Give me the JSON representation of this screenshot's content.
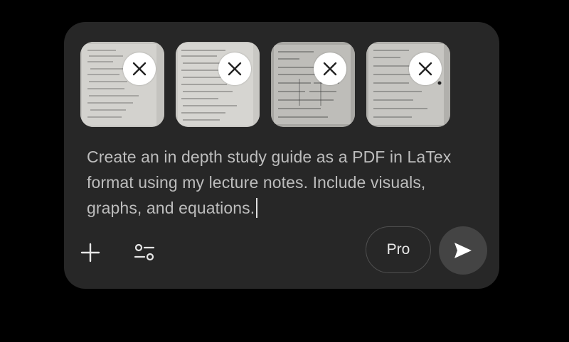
{
  "composer": {
    "attachments": [
      {
        "label": "lecture notes page 1",
        "remove_icon": "close-icon"
      },
      {
        "label": "lecture notes page 2",
        "remove_icon": "close-icon"
      },
      {
        "label": "lecture notes page 3",
        "remove_icon": "close-icon"
      },
      {
        "label": "lecture notes page 4",
        "remove_icon": "close-icon"
      }
    ],
    "prompt_text": "Create an in depth study guide as a PDF in LaTex format using my lecture notes. Include visuals, graphs, and equations.",
    "toolbar": {
      "add_icon": "plus-icon",
      "tools_icon": "sliders-icon",
      "pro_label": "Pro",
      "send_icon": "send-icon"
    }
  },
  "colors": {
    "background": "#000000",
    "composer_bg": "#272727",
    "prompt_text": "#bdbdbd",
    "send_button_bg": "#444444"
  }
}
